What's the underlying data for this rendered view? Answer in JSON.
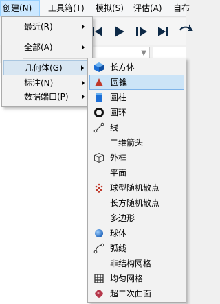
{
  "menubar": {
    "items": [
      {
        "label": "创建(N)"
      },
      {
        "label": "工具箱(T)"
      },
      {
        "label": "模拟(S)"
      },
      {
        "label": "评估(A)"
      },
      {
        "label": "自布"
      }
    ]
  },
  "create_menu": {
    "items": [
      {
        "label": "最近(R)",
        "icon": "none",
        "submenu": true
      },
      {
        "label": "全部(A)",
        "icon": "none",
        "submenu": true
      },
      {
        "label": "几何体(G)",
        "icon": "none",
        "submenu": true,
        "highlighted": true
      },
      {
        "label": "标注(N)",
        "icon": "none",
        "submenu": true
      },
      {
        "label": "数据端口(P)",
        "icon": "none",
        "submenu": true
      }
    ]
  },
  "geometry_submenu": {
    "items": [
      {
        "label": "长方体",
        "icon": "cube-icon"
      },
      {
        "label": "圆锥",
        "icon": "cone-icon",
        "highlighted": true
      },
      {
        "label": "圆柱",
        "icon": "cylinder-icon"
      },
      {
        "label": "圆环",
        "icon": "torus-icon"
      },
      {
        "label": "线",
        "icon": "line-icon"
      },
      {
        "label": "二维箭头",
        "icon": "none"
      },
      {
        "label": "外框",
        "icon": "outline-box-icon"
      },
      {
        "label": "平面",
        "icon": "none"
      },
      {
        "label": "球型随机散点",
        "icon": "scatter-points-icon"
      },
      {
        "label": "长方随机散点",
        "icon": "none"
      },
      {
        "label": "多边形",
        "icon": "none"
      },
      {
        "label": "球体",
        "icon": "sphere-icon"
      },
      {
        "label": "弧线",
        "icon": "arc-icon"
      },
      {
        "label": "非结构网格",
        "icon": "none"
      },
      {
        "label": "均匀网格",
        "icon": "grid-icon"
      },
      {
        "label": "超二次曲面",
        "icon": "superquadric-icon"
      }
    ]
  },
  "colors": {
    "accent_blue": "#1d6fd6",
    "cone_red": "#c0392b",
    "menu_highlight": "#cce4f7"
  }
}
